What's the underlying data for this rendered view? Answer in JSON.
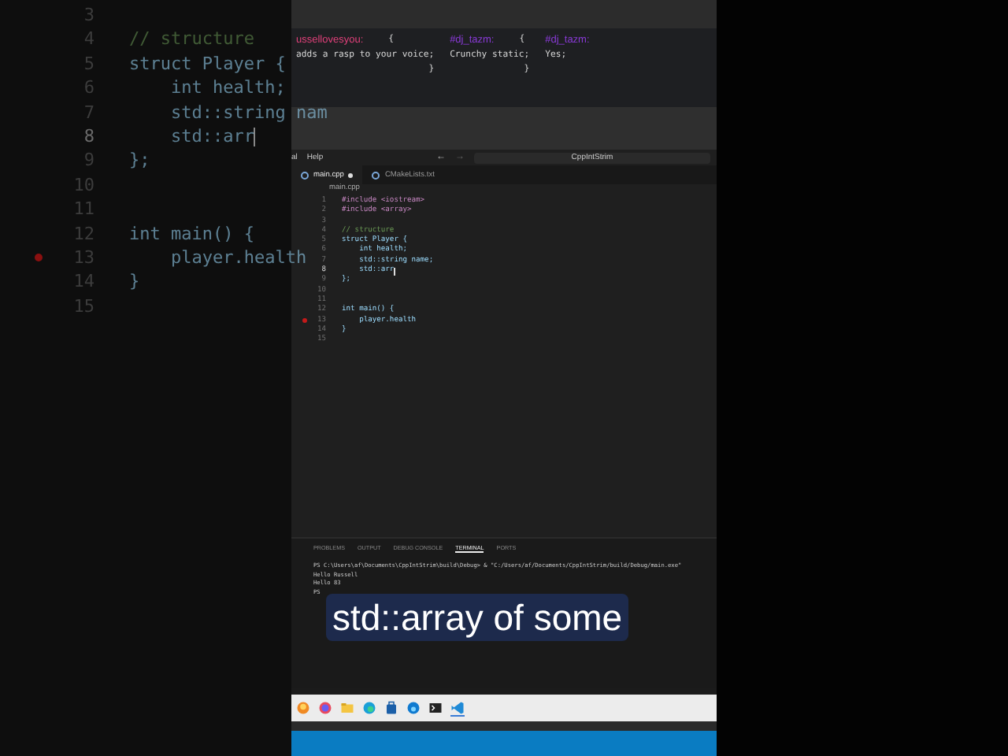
{
  "zoomed_editor": {
    "lines": [
      {
        "number": "3",
        "breakpoint": false,
        "current": false
      },
      {
        "number": "4",
        "code": "// structure",
        "kind": "comment",
        "breakpoint": false,
        "current": false
      },
      {
        "number": "5",
        "code": "struct Player {",
        "kind": "code",
        "breakpoint": false,
        "current": false
      },
      {
        "number": "6",
        "code": "    int health;",
        "kind": "code",
        "breakpoint": false,
        "current": false
      },
      {
        "number": "7",
        "code": "    std::string nam",
        "kind": "code",
        "breakpoint": false,
        "current": false
      },
      {
        "number": "8",
        "code": "    std::arr",
        "kind": "code",
        "breakpoint": false,
        "current": true
      },
      {
        "number": "9",
        "code": "};",
        "kind": "code",
        "breakpoint": false,
        "current": false
      },
      {
        "number": "10",
        "breakpoint": false,
        "current": false
      },
      {
        "number": "11",
        "breakpoint": false,
        "current": false
      },
      {
        "number": "12",
        "code": "int main() {",
        "kind": "code",
        "breakpoint": false,
        "current": false
      },
      {
        "number": "13",
        "code": "    player.health",
        "kind": "code",
        "breakpoint": true,
        "current": false
      },
      {
        "number": "14",
        "code": "}",
        "kind": "code",
        "breakpoint": false,
        "current": false
      },
      {
        "number": "15",
        "breakpoint": false,
        "current": false
      }
    ]
  },
  "chat": [
    {
      "user": "ussellovesyou:",
      "color": "#e0407a",
      "open": "{",
      "message": "adds a rasp to your voice;",
      "close": "}"
    },
    {
      "user": "#dj_tazm:",
      "color": "#8a3ad8",
      "open": "{",
      "message": "Crunchy static;",
      "close": "}"
    },
    {
      "user": "#dj_tazm:",
      "color": "#8a3ad8",
      "message": "Yes;"
    }
  ],
  "menu_bar": {
    "items": [
      "al",
      "Help"
    ],
    "back": "←",
    "forward": "→",
    "search": "CppIntStrim"
  },
  "tabs": [
    {
      "label": "main.cpp",
      "selected": true,
      "modified": true
    },
    {
      "label": "CMakeLists.txt",
      "selected": false,
      "modified": false
    }
  ],
  "breadcrumb": "main.cpp",
  "editor": {
    "lines": [
      {
        "number": "1",
        "code": "#include <iostream>",
        "kind": "include",
        "breakpoint": false,
        "current": false
      },
      {
        "number": "2",
        "code": "#include <array>",
        "kind": "include",
        "breakpoint": false,
        "current": false
      },
      {
        "number": "3",
        "breakpoint": false,
        "current": false
      },
      {
        "number": "4",
        "code": "// structure",
        "kind": "comment",
        "breakpoint": false,
        "current": false
      },
      {
        "number": "5",
        "code": "struct Player {",
        "kind": "code",
        "breakpoint": false,
        "current": false
      },
      {
        "number": "6",
        "code": "    int health;",
        "kind": "code",
        "breakpoint": false,
        "current": false
      },
      {
        "number": "7",
        "code": "    std::string name;",
        "kind": "code",
        "breakpoint": false,
        "current": false
      },
      {
        "number": "8",
        "code": "    std::arr",
        "kind": "code",
        "breakpoint": false,
        "current": true
      },
      {
        "number": "9",
        "code": "};",
        "kind": "code",
        "breakpoint": false,
        "current": false
      },
      {
        "number": "10",
        "breakpoint": false,
        "current": false
      },
      {
        "number": "11",
        "breakpoint": false,
        "current": false
      },
      {
        "number": "12",
        "code": "int main() {",
        "kind": "code",
        "breakpoint": false,
        "current": false
      },
      {
        "number": "13",
        "code": "    player.health",
        "kind": "code",
        "breakpoint": true,
        "current": false
      },
      {
        "number": "14",
        "code": "}",
        "kind": "code",
        "breakpoint": false,
        "current": false
      },
      {
        "number": "15",
        "breakpoint": false,
        "current": false
      }
    ]
  },
  "panel_tabs": [
    {
      "label": "PROBLEMS",
      "selected": false
    },
    {
      "label": "OUTPUT",
      "selected": false
    },
    {
      "label": "DEBUG CONSOLE",
      "selected": false
    },
    {
      "label": "TERMINAL",
      "selected": true
    },
    {
      "label": "PORTS",
      "selected": false
    }
  ],
  "terminal": [
    "PS C:\\Users\\af\\Documents\\CppIntStrim\\build\\Debug> & \"C:/Users/af/Documents/CppIntStrim/build/Debug/main.exe\"",
    "Hello Russell",
    "Hello 83",
    "PS"
  ],
  "caption": "std::array of some",
  "taskbar": [
    {
      "kind": "fox",
      "active": false
    },
    {
      "kind": "ring",
      "active": false
    },
    {
      "kind": "folder",
      "active": false
    },
    {
      "kind": "wave",
      "active": false
    },
    {
      "kind": "bag",
      "active": false
    },
    {
      "kind": "wave2",
      "active": false
    },
    {
      "kind": "terminal",
      "active": false
    },
    {
      "kind": "code",
      "active": true
    }
  ]
}
